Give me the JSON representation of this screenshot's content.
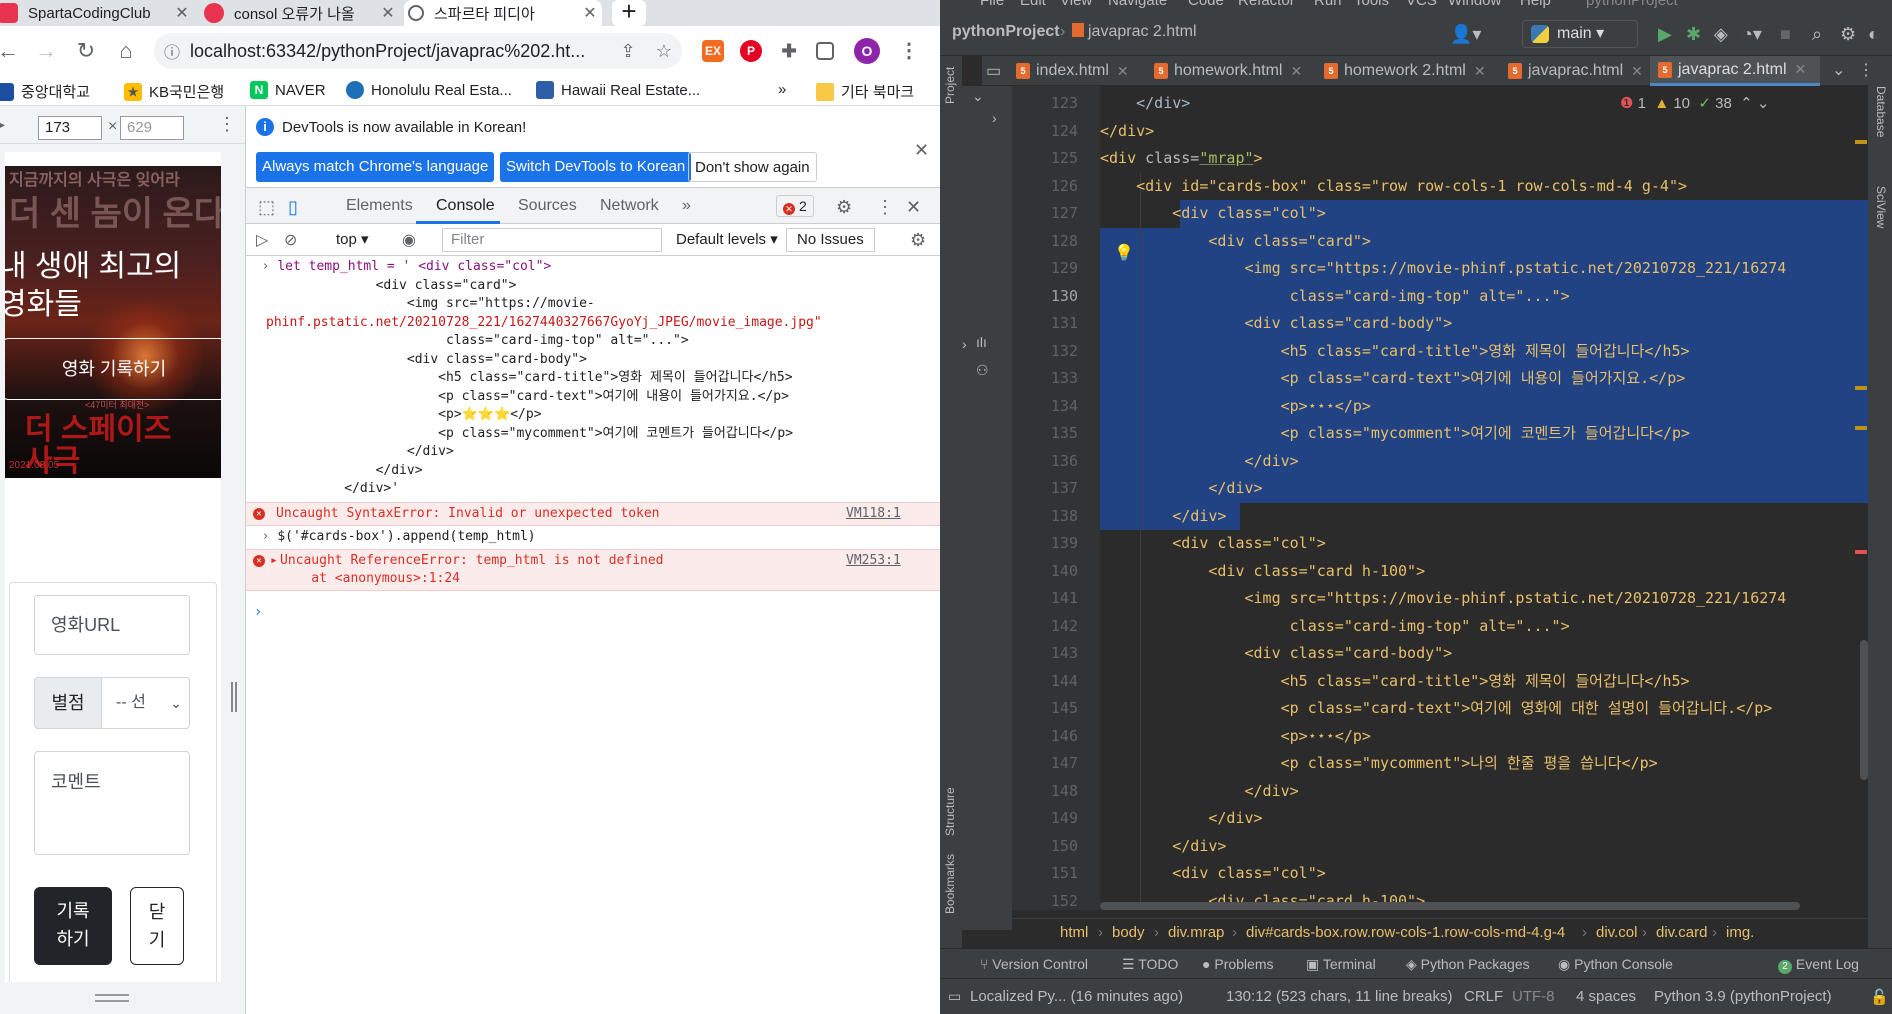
{
  "chrome": {
    "tabs": [
      {
        "title": "SpartaCodingClub"
      },
      {
        "title": "consol 오류가 나올"
      },
      {
        "title": "스파르타 피디아"
      }
    ],
    "url": "localhost:63342/pythonProject/javaprac%202.ht...",
    "profile_initial": "O",
    "bookmarks": [
      "중앙대학교",
      "KB국민은행",
      "NAVER",
      "Honolulu Real Esta...",
      "Hawaii Real Estate...",
      "기타 북마크"
    ],
    "bookmarks_more": "»"
  },
  "page": {
    "width": "173",
    "height": "629",
    "poster_top": "지금까지의 사극은 잊어라",
    "poster_big": "더 센 놈이 온다",
    "title_line1": "내 생애 최고의",
    "title_line2": "영화들",
    "record_button": "영화 기록하기",
    "poster_sub": "<47미터 최대전>",
    "poster_red": "더 스페이즈",
    "poster_red2": "사극",
    "poster_date": "2021.08.05",
    "url_placeholder": "영화URL",
    "star_label": "별점",
    "star_select": "-- 선택",
    "comment_placeholder": "코멘트",
    "save_button_line1": "기록",
    "save_button_line2": "하기",
    "close_button_line1": "닫",
    "close_button_line2": "기"
  },
  "devtools": {
    "info_message": "DevTools is now available in Korean!",
    "btn_match": "Always match Chrome's language",
    "btn_switch": "Switch DevTools to Korean",
    "btn_dont": "Don't show again",
    "tabs": [
      "Elements",
      "Console",
      "Sources",
      "Network"
    ],
    "more_tabs": "»",
    "error_count": "2",
    "context": "top",
    "filter_placeholder": "Filter",
    "levels": "Default levels",
    "no_issues": "No Issues",
    "console": {
      "input1_l1": "let temp_html = ' <div class=\"col\">",
      "input1_l2": "              <div class=\"card\">",
      "input1_l3": "                  <img src=\"https://movie-",
      "input1_l4": "phinf.pstatic.net/20210728_221/1627440327667GyoYj_JPEG/movie_image.jpg\"",
      "input1_l5": "                       class=\"card-img-top\" alt=\"...\">",
      "input1_l6": "                  <div class=\"card-body\">",
      "input1_l7": "                      <h5 class=\"card-title\">영화 제목이 들어갑니다</h5>",
      "input1_l8": "                      <p class=\"card-text\">여기에 내용이 들어가지요.</p>",
      "input1_l9": "                      <p>⭐⭐⭐</p>",
      "input1_l10": "                      <p class=\"mycomment\">여기에 코멘트가 들어갑니다</p>",
      "input1_l11": "                  </div>",
      "input1_l12": "              </div>",
      "input1_l13": "          </div>'",
      "error1": "Uncaught SyntaxError: Invalid or unexpected token",
      "error1_src": "VM118:1",
      "input2": "$('#cards-box').append(temp_html)",
      "error2_l1": "Uncaught ReferenceError: temp_html is not defined",
      "error2_l2": "    at <anonymous>:1:24",
      "error2_src": "VM253:1"
    }
  },
  "ide": {
    "menu": [
      "File",
      "Edit",
      "View",
      "Navigate",
      "Code",
      "Refactor",
      "Run",
      "Tools",
      "VCS",
      "Window",
      "Help",
      "pythonProject"
    ],
    "project": "pythonProject",
    "file": "javaprac 2.html",
    "branch": "main",
    "tabs": [
      "index.html",
      "homework.html",
      "homework 2.html",
      "javaprac.html",
      "javaprac 2.html"
    ],
    "errors": "1",
    "warnings": "10",
    "ok": "38",
    "left_tools": [
      "Project",
      "Structure",
      "Bookmarks"
    ],
    "right_tools": [
      "Database",
      "SciView"
    ],
    "line_numbers": [
      "123",
      "124",
      "125",
      "126",
      "127",
      "128",
      "129",
      "130",
      "131",
      "132",
      "133",
      "134",
      "135",
      "136",
      "137",
      "138",
      "139",
      "140",
      "141",
      "142",
      "143",
      "144",
      "145",
      "146",
      "147",
      "148",
      "149",
      "150",
      "151",
      "152"
    ],
    "breadcrumbs": [
      "html",
      "body",
      "div.mrap",
      "div#cards-box.row.row-cols-1.row-cols-md-4.g-4",
      "div.col",
      "div.card",
      "img."
    ],
    "bottom_tabs": [
      "Version Control",
      "TODO",
      "Problems",
      "Terminal",
      "Python Packages",
      "Python Console",
      "Event Log"
    ],
    "event_count": "2",
    "status": {
      "left": "Localized Py... (16 minutes ago)",
      "pos": "130:12 (523 chars, 11 line breaks)",
      "crlf": "CRLF",
      "enc": "UTF-8",
      "indent": "4 spaces",
      "interp": "Python 3.9 (pythonProject)"
    },
    "code": {
      "l123": "    </div>",
      "l124": "</div>",
      "l125_a": "<div ",
      "l125_b": "class=",
      "l125_c": "\"mrap\"",
      "l126": "    <div id=\"cards-box\" class=\"row row-cols-1 row-cols-md-4 g-4\">",
      "l127": "        <div class=\"col\">",
      "l128": "            <div class=\"card\">",
      "l129": "                <img src=\"https://movie-phinf.pstatic.net/20210728_221/16274",
      "l130": "                     class=\"card-img-top\" alt=\"...\">",
      "l131": "                <div class=\"card-body\">",
      "l132": "                    <h5 class=\"card-title\">영화 제목이 들어갑니다</h5>",
      "l133": "                    <p class=\"card-text\">여기에 내용이 들어가지요.</p>",
      "l134": "                    <p>⋆⋆⋆</p>",
      "l135": "                    <p class=\"mycomment\">여기에 코멘트가 들어갑니다</p>",
      "l136": "                </div>",
      "l137": "            </div>",
      "l138": "        </div>",
      "l139": "        <div class=\"col\">",
      "l140": "            <div class=\"card h-100\">",
      "l141": "                <img src=\"https://movie-phinf.pstatic.net/20210728_221/16274",
      "l142": "                     class=\"card-img-top\" alt=\"...\">",
      "l143": "                <div class=\"card-body\">",
      "l144": "                    <h5 class=\"card-title\">영화 제목이 들어갑니다</h5>",
      "l145": "                    <p class=\"card-text\">여기에 영화에 대한 설명이 들어갑니다.</p>",
      "l146": "                    <p>⋆⋆⋆</p>",
      "l147": "                    <p class=\"mycomment\">나의 한줄 평을 씁니다</p>",
      "l148": "                </div>",
      "l149": "            </div>",
      "l150": "        </div>",
      "l151": "        <div class=\"col\">",
      "l152": "            <div class=\"card h-100\">"
    }
  }
}
